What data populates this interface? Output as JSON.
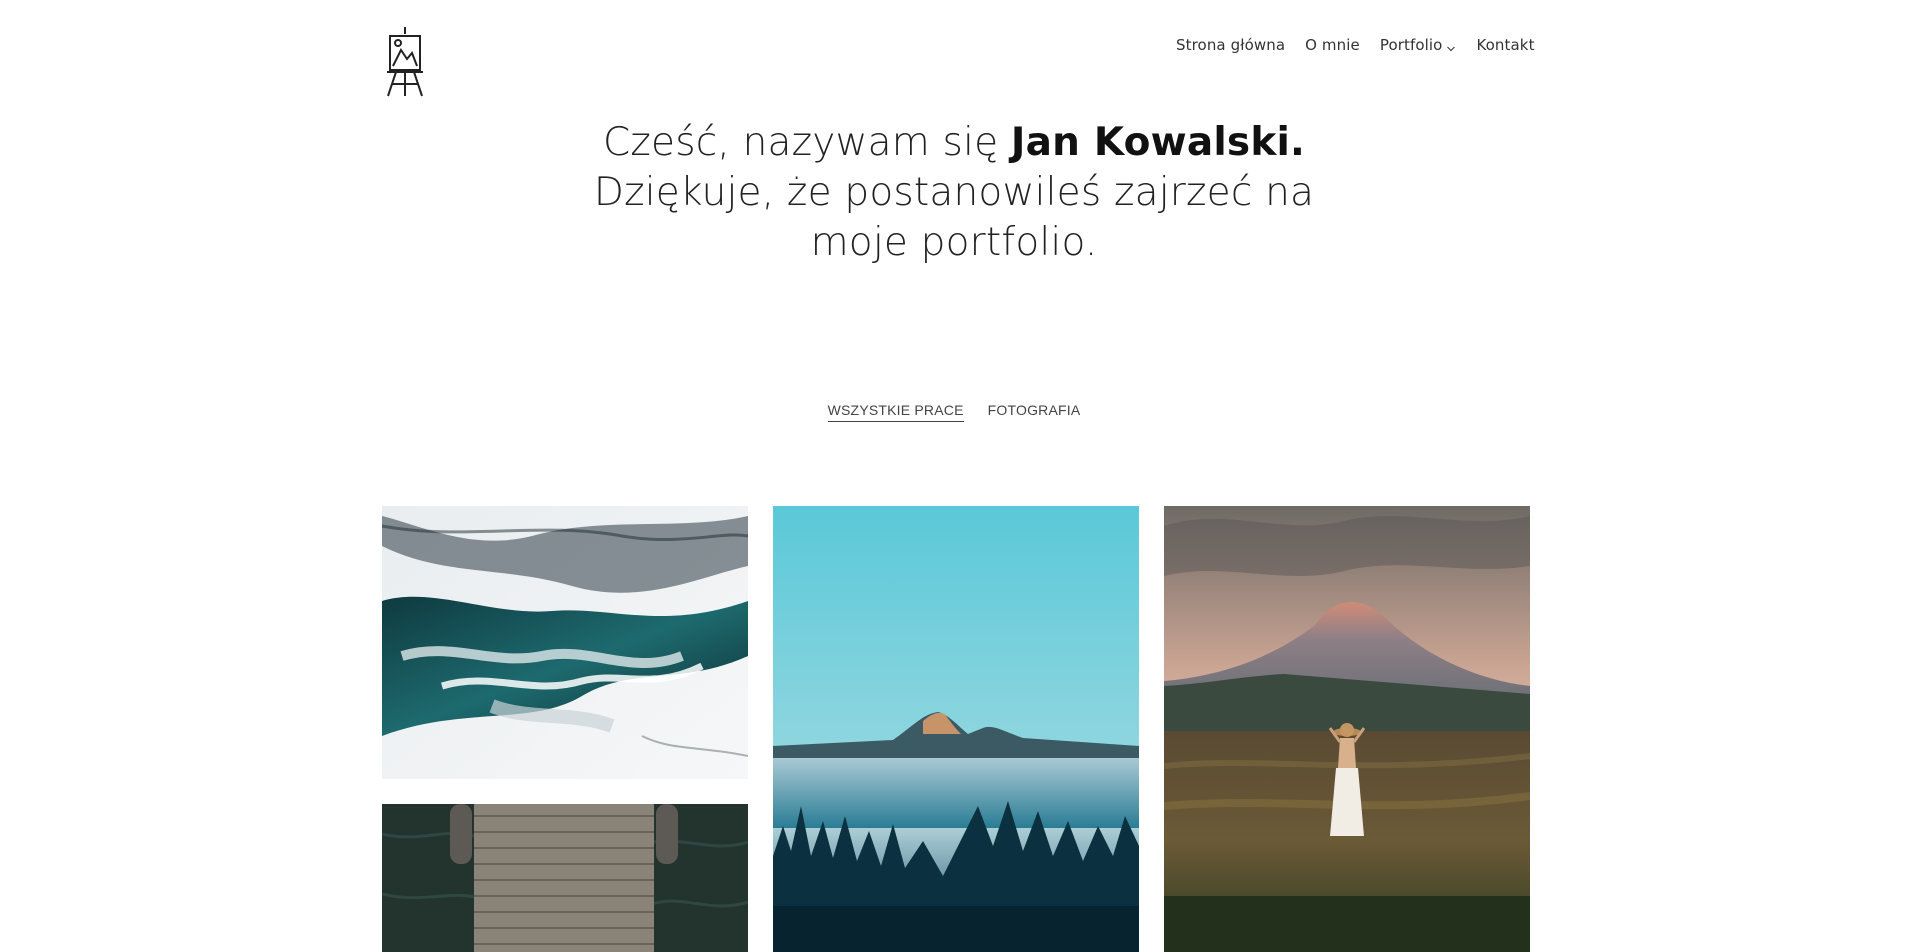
{
  "nav": {
    "items": [
      {
        "label": "Strona główna"
      },
      {
        "label": "O mnie"
      },
      {
        "label": "Portfolio",
        "has_dropdown": true
      },
      {
        "label": "Kontakt"
      }
    ]
  },
  "hero": {
    "line1_prefix": "Cześć, nazywam się ",
    "line1_name": "Jan Kowalski.",
    "line2": "Dziękuje, że postanowileś zajrzeć na",
    "line3": "moje portfolio."
  },
  "filters": {
    "items": [
      {
        "label": "WSZYSTKIE PRACE",
        "active": true
      },
      {
        "label": "FOTOGRAFIA",
        "active": false
      }
    ]
  },
  "gallery": {
    "items": [
      {
        "subject": "aerial frozen river"
      },
      {
        "subject": "mountain peak above fog forest"
      },
      {
        "subject": "woman in hat facing volcano at sunset"
      },
      {
        "subject": "wooden pier over dark water"
      }
    ]
  },
  "icons": {
    "logo": "easel-icon",
    "dropdown": "chevron-down-icon"
  }
}
